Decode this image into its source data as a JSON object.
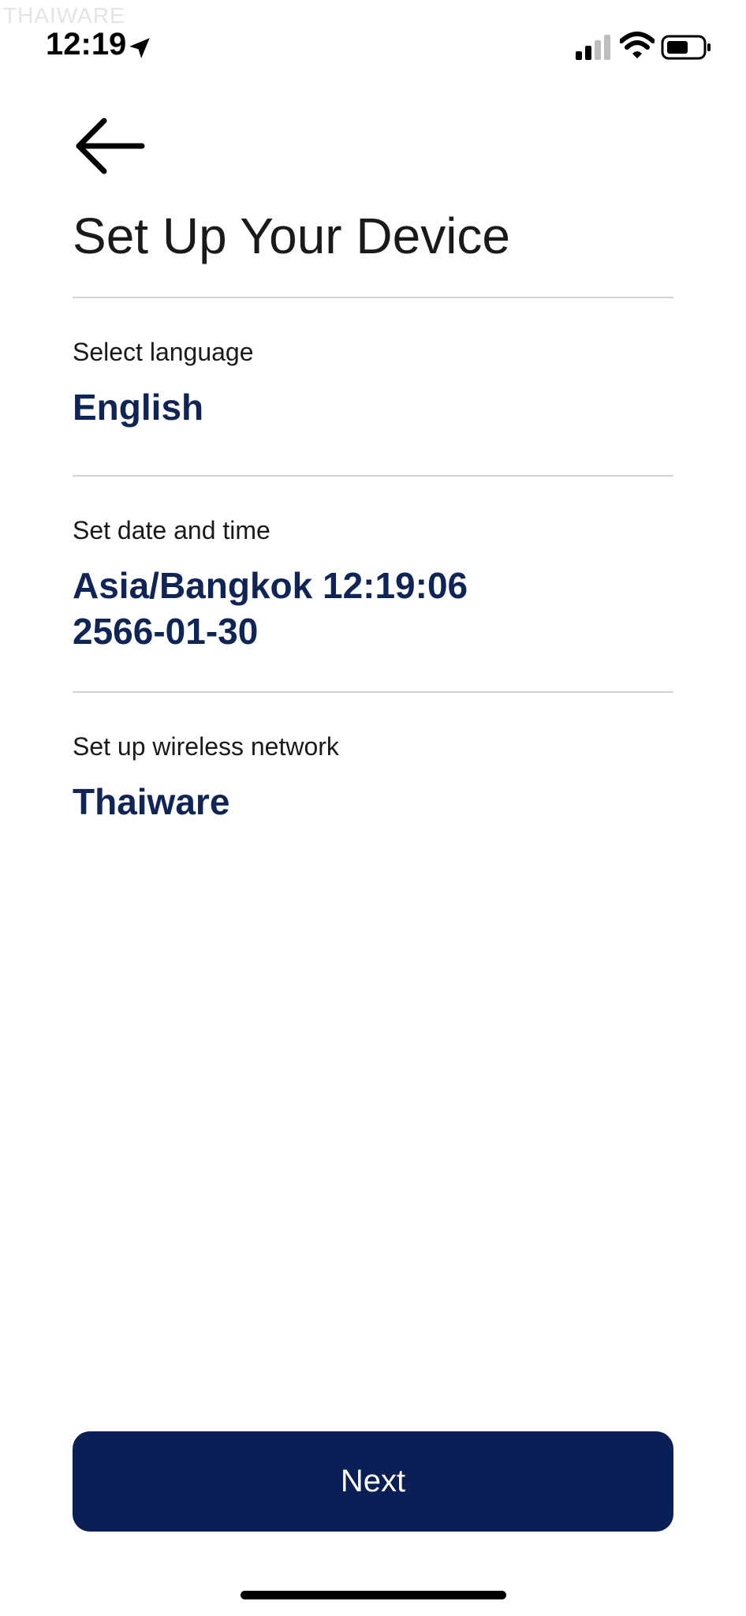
{
  "watermark": "THAIWARE",
  "status_bar": {
    "time": "12:19",
    "icons": [
      "location-arrow-icon",
      "cellular-signal-icon",
      "wifi-icon",
      "battery-icon"
    ]
  },
  "header": {
    "back_icon": "arrow-left-icon",
    "title": "Set Up Your Device"
  },
  "settings": [
    {
      "label": "Select language",
      "value": "English"
    },
    {
      "label": "Set date and time",
      "value_line1": "Asia/Bangkok 12:19:06",
      "value_line2": "2566-01-30"
    },
    {
      "label": "Set up wireless network",
      "value": "Thaiware"
    }
  ],
  "footer": {
    "next_label": "Next"
  },
  "colors": {
    "accent": "#0f2557",
    "button": "#0a1f56",
    "divider": "#d4d4d4"
  }
}
